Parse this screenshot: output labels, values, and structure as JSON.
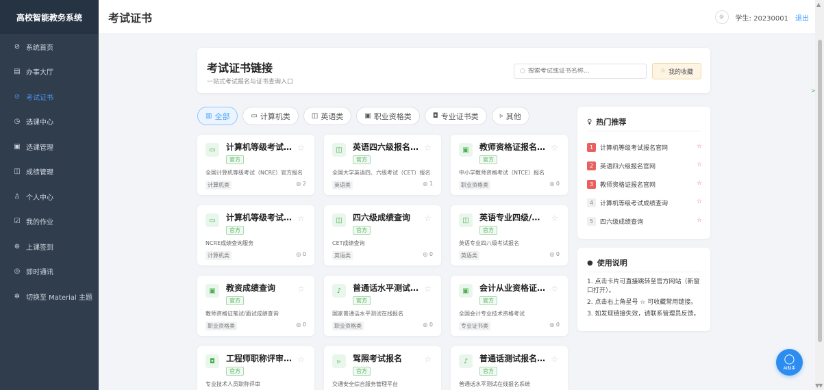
{
  "app": {
    "name": "高校智能教务系统"
  },
  "sidebar": {
    "items": [
      {
        "icon": "⊘",
        "label": "系统首页",
        "active": false
      },
      {
        "icon": "▤",
        "label": "办事大厅",
        "active": false
      },
      {
        "icon": "⊘",
        "label": "考试证书",
        "active": true
      },
      {
        "icon": "◷",
        "label": "选课中心",
        "active": false
      },
      {
        "icon": "▣",
        "label": "选课管理",
        "active": false
      },
      {
        "icon": "◫",
        "label": "成绩管理",
        "active": false
      },
      {
        "icon": "♙",
        "label": "个人中心",
        "active": false
      },
      {
        "icon": "☑",
        "label": "我的作业",
        "active": false
      },
      {
        "icon": "⊕",
        "label": "上课签到",
        "active": false
      },
      {
        "icon": "◎",
        "label": "即时通讯",
        "active": false
      },
      {
        "icon": "✲",
        "label": "切换至 Material 主题",
        "active": false
      }
    ]
  },
  "header": {
    "title": "考试证书",
    "theme_icon": "☼",
    "user": "学生: 20230001",
    "logout": "退出"
  },
  "top": {
    "title": "考试证书链接",
    "subtitle": "一站式考试报名与证书查询入口",
    "search_placeholder": "搜索考试或证书名称...",
    "fav_label": "我的收藏"
  },
  "tabs": [
    {
      "icon": "▥",
      "label": "全部",
      "active": true
    },
    {
      "icon": "▭",
      "label": "计算机类",
      "active": false
    },
    {
      "icon": "◫",
      "label": "英语类",
      "active": false
    },
    {
      "icon": "▣",
      "label": "职业资格类",
      "active": false
    },
    {
      "icon": "◘",
      "label": "专业证书类",
      "active": false
    },
    {
      "icon": "▹",
      "label": "其他",
      "active": false
    }
  ],
  "cards": [
    {
      "icon": "▭",
      "title": "计算机等级考试报名官网",
      "badge": "官方",
      "desc": "全国计算机等级考试（NCRE）官方报名",
      "category": "计算机类",
      "views": "◎ 2"
    },
    {
      "icon": "◫",
      "title": "英语四六级报名官网",
      "badge": "官方",
      "desc": "全国大学英语四、六级考试（CET）报名",
      "category": "英语类",
      "views": "◎ 1"
    },
    {
      "icon": "▣",
      "title": "教师资格证报名官网",
      "badge": "官方",
      "desc": "中小学教师资格考试（NTCE）报名",
      "category": "职业资格类",
      "views": "◎ 0"
    },
    {
      "icon": "▭",
      "title": "计算机等级考试成绩查询",
      "badge": "官方",
      "desc": "NCRE成绩查询服务",
      "category": "计算机类",
      "views": "◎ 0"
    },
    {
      "icon": "◫",
      "title": "四六级成绩查询",
      "badge": "官方",
      "desc": "CET成绩查询",
      "category": "英语类",
      "views": "◎ 0"
    },
    {
      "icon": "◫",
      "title": "英语专业四级/八级",
      "badge": "官方",
      "desc": "英语专业四八级考试报名",
      "category": "英语类",
      "views": "◎ 0"
    },
    {
      "icon": "▣",
      "title": "教资成绩查询",
      "badge": "官方",
      "desc": "教师资格证笔试/面试成绩查询",
      "category": "职业资格类",
      "views": "◎ 0"
    },
    {
      "icon": "♪",
      "title": "普通话水平测试报名",
      "badge": "官方",
      "desc": "国家普通话水平测试在线报名",
      "category": "职业资格类",
      "views": "◎ 0"
    },
    {
      "icon": "▣",
      "title": "会计从业资格证报名",
      "badge": "官方",
      "desc": "全国会计专业技术资格考试",
      "category": "专业证书类",
      "views": "◎ 0"
    },
    {
      "icon": "◘",
      "title": "工程师职称评审官网",
      "badge": "官方",
      "desc": "专业技术人员职称评审",
      "category": "",
      "views": ""
    },
    {
      "icon": "▹",
      "title": "驾照考试报名",
      "badge": "官方",
      "desc": "交通安全综合服务管理平台",
      "category": "",
      "views": ""
    },
    {
      "icon": "♪",
      "title": "普通话测试报名官网",
      "badge": "官方",
      "desc": "普通话水平测试在线报名系统",
      "category": "",
      "views": ""
    }
  ],
  "hot": {
    "icon": "♀",
    "title": "热门推荐",
    "items": [
      {
        "rank": "1",
        "label": "计算机等级考试报名官网"
      },
      {
        "rank": "2",
        "label": "英语四六级报名官网"
      },
      {
        "rank": "3",
        "label": "教师资格证报名官网"
      },
      {
        "rank": "4",
        "label": "计算机等级考试成绩查询"
      },
      {
        "rank": "5",
        "label": "四六级成绩查询"
      }
    ]
  },
  "usage": {
    "icon": "●",
    "title": "使用说明",
    "lines": [
      "1. 点击卡片可直接跳转至官方网站（新窗口打开）。",
      "2. 点击右上角星号 ☆ 可收藏常用链接。",
      "3. 如发现链接失效，请联系管理员反馈。"
    ]
  },
  "ai": {
    "label": "AI助手"
  },
  "colors": {
    "sidebar": "#2f3d4d",
    "accent": "#409eff",
    "official": "#4caf50",
    "hot": "#e86060"
  }
}
